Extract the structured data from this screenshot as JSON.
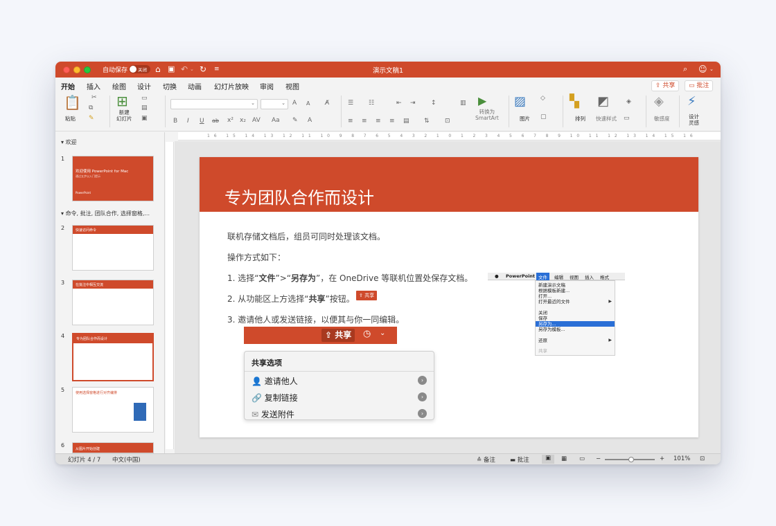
{
  "colors": {
    "accent": "#cf4a2b",
    "highlight": "#2a6fd6"
  },
  "titlebar": {
    "autosave": "自动保存",
    "toggle_state": "关闭",
    "doc_title": "演示文稿1"
  },
  "menu": {
    "tabs": [
      "开始",
      "插入",
      "绘图",
      "设计",
      "切换",
      "动画",
      "幻灯片放映",
      "审阅",
      "视图"
    ],
    "share": "共享",
    "comments": "批注"
  },
  "ribbon": {
    "paste": "粘贴",
    "new_slide": "新建\n幻灯片",
    "bold": "B",
    "italic": "I",
    "underline": "U",
    "strike": "ab",
    "superscript": "x²",
    "subscript": "x₂",
    "char_spacing": "AV",
    "change_case": "Aa",
    "grow": "A",
    "shrink": "A",
    "convert_smartart": "转换为\nSmartArt",
    "picture": "图片",
    "arrange": "排列",
    "quick_styles": "快速样式",
    "sensitivity": "敏感度",
    "designer": "设计\n灵感"
  },
  "sidebar": {
    "section1": "欢迎",
    "section2": "命令, 批注, 团队合作, 选择窗格,...",
    "slides": [
      {
        "num": "1",
        "title": "欢迎使用 PowerPoint for Mac",
        "subtitle": "通过五步以入门提示",
        "logo": "PowerPoint"
      },
      {
        "num": "2",
        "title": "快速访问命令"
      },
      {
        "num": "3",
        "title": "在批注中相互交流"
      },
      {
        "num": "4",
        "title": "专为团队合作而设计"
      },
      {
        "num": "5",
        "title": "使用选择窗格进行对齐编排"
      },
      {
        "num": "6",
        "title": "从图片开始创建"
      }
    ]
  },
  "ruler": {
    "h": "16 15 14 13 12 11 10 9 8 7 6 5 4 3 2 1 0 1 2 3 4 5 6 7 8 9 10 11 12 13 14 15 16"
  },
  "slide": {
    "title": "专为团队合作而设计",
    "line1": "联机存储文档后，组员可同时处理该文档。",
    "line2": "操作方式如下：",
    "step1_pre": "1.  选择“",
    "step1_b1": "文件",
    "step1_mid": "”>“",
    "step1_b2": "另存为",
    "step1_post": "”，在 OneDrive 等联机位置处保存文档。",
    "step2_pre": "2.  从功能区上方选择“",
    "step2_b": "共享",
    "step2_post": "”按钮。",
    "inline_share": "共享",
    "step3": "3.  邀请他人或发送链接，以便其与你一同编辑。",
    "share_screenshot": {
      "button": "共享",
      "header": "共享选项",
      "items": [
        "邀请他人",
        "复制链接",
        "发送附件"
      ]
    },
    "menu_screenshot": {
      "bar": [
        "PowerPoint",
        "文件",
        "编辑",
        "视图",
        "插入",
        "格式"
      ],
      "items": [
        "新建演示文稿",
        "根据模板新建...",
        "打开...",
        "打开最近的文件",
        "关闭",
        "保存",
        "另存为...",
        "另存为模板...",
        "还原",
        "共享"
      ],
      "highlight": "另存为..."
    }
  },
  "status": {
    "slide_info": "幻灯片 4 / 7",
    "language": "中文(中国)",
    "notes": "备注",
    "comments": "批注",
    "zoom": "101%"
  }
}
